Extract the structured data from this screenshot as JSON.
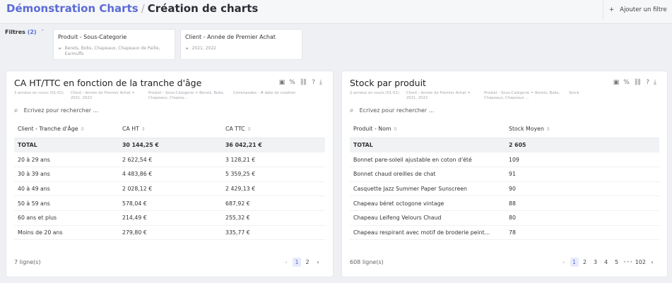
{
  "header": {
    "crumb1": "Démonstration Charts",
    "separator": "/",
    "crumb2": "Création de charts",
    "add_filter": "Ajouter un filtre"
  },
  "filters": {
    "label": "Filtres",
    "count": "(2)",
    "cards": [
      {
        "title": "Produit - Sous-Categorie",
        "value": "Berets, Bobs, Chapeaux, Chapeaux de Paille, Earmuffs"
      },
      {
        "title": "Client - Année de Premier Achat",
        "value": "2021, 2022"
      }
    ]
  },
  "panels": [
    {
      "title": "CA HT/TTC en fonction de la tranche d'âge",
      "meta": [
        "3 années en cours (01-01)",
        "Client - Année de Premier Achat = 2021, 2022",
        "Produit - Sous-Categorie = Berets, Bobs, Chapeaux, Chapea...",
        "Commandes - # date de création"
      ],
      "search_placeholder": "Ecrivez pour rechercher ...",
      "columns": [
        "Client - Tranche d'Âge",
        "CA HT",
        "CA TTC"
      ],
      "total": [
        "TOTAL",
        "30 144,25 €",
        "36 042,21 €"
      ],
      "rows": [
        [
          "20 à 29 ans",
          "2 622,54 €",
          "3 128,21 €"
        ],
        [
          "30 à 39 ans",
          "4 483,86 €",
          "5 359,25 €"
        ],
        [
          "40 à 49 ans",
          "2 028,12 €",
          "2 429,13 €"
        ],
        [
          "50 à 59 ans",
          "578,04 €",
          "687,92 €"
        ],
        [
          "60 ans et plus",
          "214,49 €",
          "255,32 €"
        ],
        [
          "Moins de 20 ans",
          "279,80 €",
          "335,77 €"
        ]
      ],
      "footer": "7 ligne(s)",
      "pages": [
        "‹",
        "1",
        "2",
        "›"
      ]
    },
    {
      "title": "Stock par produit",
      "meta": [
        "2 années en cours (01-01)",
        "Client - Année de Premier Achat = 2021, 2022",
        "Produit - Sous-Categorie = Berets, Bobs, Chapeaux, Chapeaux ...",
        "Stock"
      ],
      "search_placeholder": "Ecrivez pour rechercher ...",
      "columns": [
        "Produit - Nom",
        "Stock Moyen"
      ],
      "total": [
        "TOTAL",
        "2 605"
      ],
      "rows": [
        [
          "Bonnet pare-soleil ajustable en coton d'été",
          "109"
        ],
        [
          "Bonnet chaud oreilles de chat",
          "91"
        ],
        [
          "Casquette Jazz Summer Paper Sunscreen",
          "90"
        ],
        [
          "Chapeau béret octogone vintage",
          "88"
        ],
        [
          "Chapeau Leifeng Velours Chaud",
          "80"
        ],
        [
          "Chapeau respirant avec motif de broderie peint...",
          "78"
        ]
      ],
      "footer": "608 ligne(s)",
      "pages": [
        "‹",
        "1",
        "2",
        "3",
        "4",
        "5",
        "•••",
        "102",
        "›"
      ]
    }
  ],
  "icons": [
    "plus-icon",
    "chevron-up-icon",
    "filter-icon",
    "calendar-icon",
    "percent-icon",
    "link-icon",
    "help-icon",
    "download-icon",
    "search-icon",
    "sort-icon"
  ]
}
